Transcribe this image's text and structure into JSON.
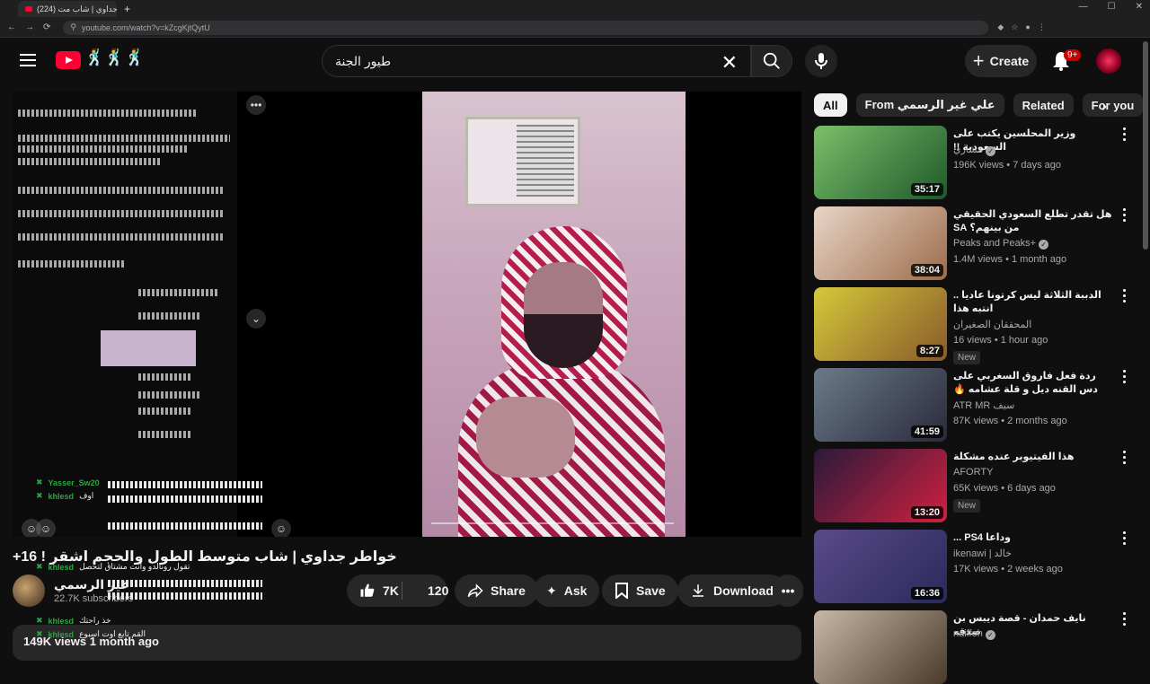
{
  "browser": {
    "tab_title": "(224) خواطر جداوي | شاب مت...",
    "url": "youtube.com/watch?v=kZcgKjtQytU"
  },
  "masthead": {
    "search_value": "طيور الجنة",
    "create_label": "Create",
    "notif_count": "9+"
  },
  "video": {
    "title": "خواطر جداوي | شاب متوسط الطول والحجم اشقر ! 16+",
    "channel": "غير الرسمي",
    "subscribers": "22.7K subscribers",
    "likes": "7K",
    "dislikes": "120",
    "share_label": "Share",
    "ask_label": "Ask",
    "save_label": "Save",
    "download_label": "Download",
    "views_date": "149K views  1 month ago"
  },
  "chat": [
    {
      "user": "Yasser_Sw20",
      "msg": ""
    },
    {
      "user": "khlesd",
      "msg": "اوف"
    },
    {
      "user": "khlesd",
      "msg": "تقول رونالدو وانت مشتاق لتحصل"
    },
    {
      "user": "khlesd",
      "msg": "خذ راحتك"
    },
    {
      "user": "khlesd",
      "msg": "القم تابع اوت اسبوع"
    }
  ],
  "chips": [
    {
      "label": "All",
      "active": true
    },
    {
      "label": "From علي غير الرسمي",
      "active": false
    },
    {
      "label": "Related",
      "active": false
    },
    {
      "label": "For you",
      "active": false
    }
  ],
  "recommendations": [
    {
      "title": "وزير المحلسين يكتب على السعودية !!",
      "channel": "مشاري",
      "verified": true,
      "meta": "196K views • 7 days ago",
      "duration": "35:17",
      "new": false,
      "thumb_colors": [
        "#7bbf6a",
        "#1e5a2a"
      ]
    },
    {
      "title": "هل تقدر تطلع السعودي الحقيقي من بينهم؟ SA",
      "channel": "Peaks  and Peaks+",
      "verified": true,
      "meta": "1.4M views • 1 month ago",
      "duration": "38:04",
      "new": false,
      "thumb_colors": [
        "#e8d6c8",
        "#9c6b4a"
      ]
    },
    {
      "title": "الدببة الثلاثة ليس كرتونا عاديا .. انتبه هذا",
      "channel": "المحققان الصغيران",
      "verified": false,
      "meta": "16 views • 1 hour ago",
      "duration": "8:27",
      "new": true,
      "thumb_colors": [
        "#d4c93a",
        "#8a5a2a"
      ]
    },
    {
      "title": "ردة فعل فاروق السغربي على دس القنه ديل و قلة عشامه 🔥فاروق يختار الفائز بين ...",
      "channel": "ATR MR سيف",
      "verified": false,
      "meta": "87K views • 2 months ago",
      "duration": "41:59",
      "new": false,
      "thumb_colors": [
        "#6a7a8a",
        "#2a2a3a"
      ]
    },
    {
      "title": "هذا الفيتيوبر عنده مشكلة",
      "channel": "AFORTY",
      "verified": false,
      "meta": "65K views • 6 days ago",
      "duration": "13:20",
      "new": true,
      "thumb_colors": [
        "#2a1a3a",
        "#d02040"
      ]
    },
    {
      "title": "وداعا PS4 ...",
      "channel": "ikenawi | خالد",
      "verified": false,
      "meta": "17K views • 2 weeks ago",
      "duration": "16:36",
      "new": false,
      "thumb_colors": [
        "#5a4a8a",
        "#2a2a5a"
      ]
    },
    {
      "title": "نايف حمدان - قصة ديبس بن صدقه",
      "channel": "naiffoh",
      "verified": true,
      "meta": "",
      "duration": "",
      "new": false,
      "thumb_colors": [
        "#c8b8a8",
        "#4a3a2a"
      ]
    }
  ]
}
